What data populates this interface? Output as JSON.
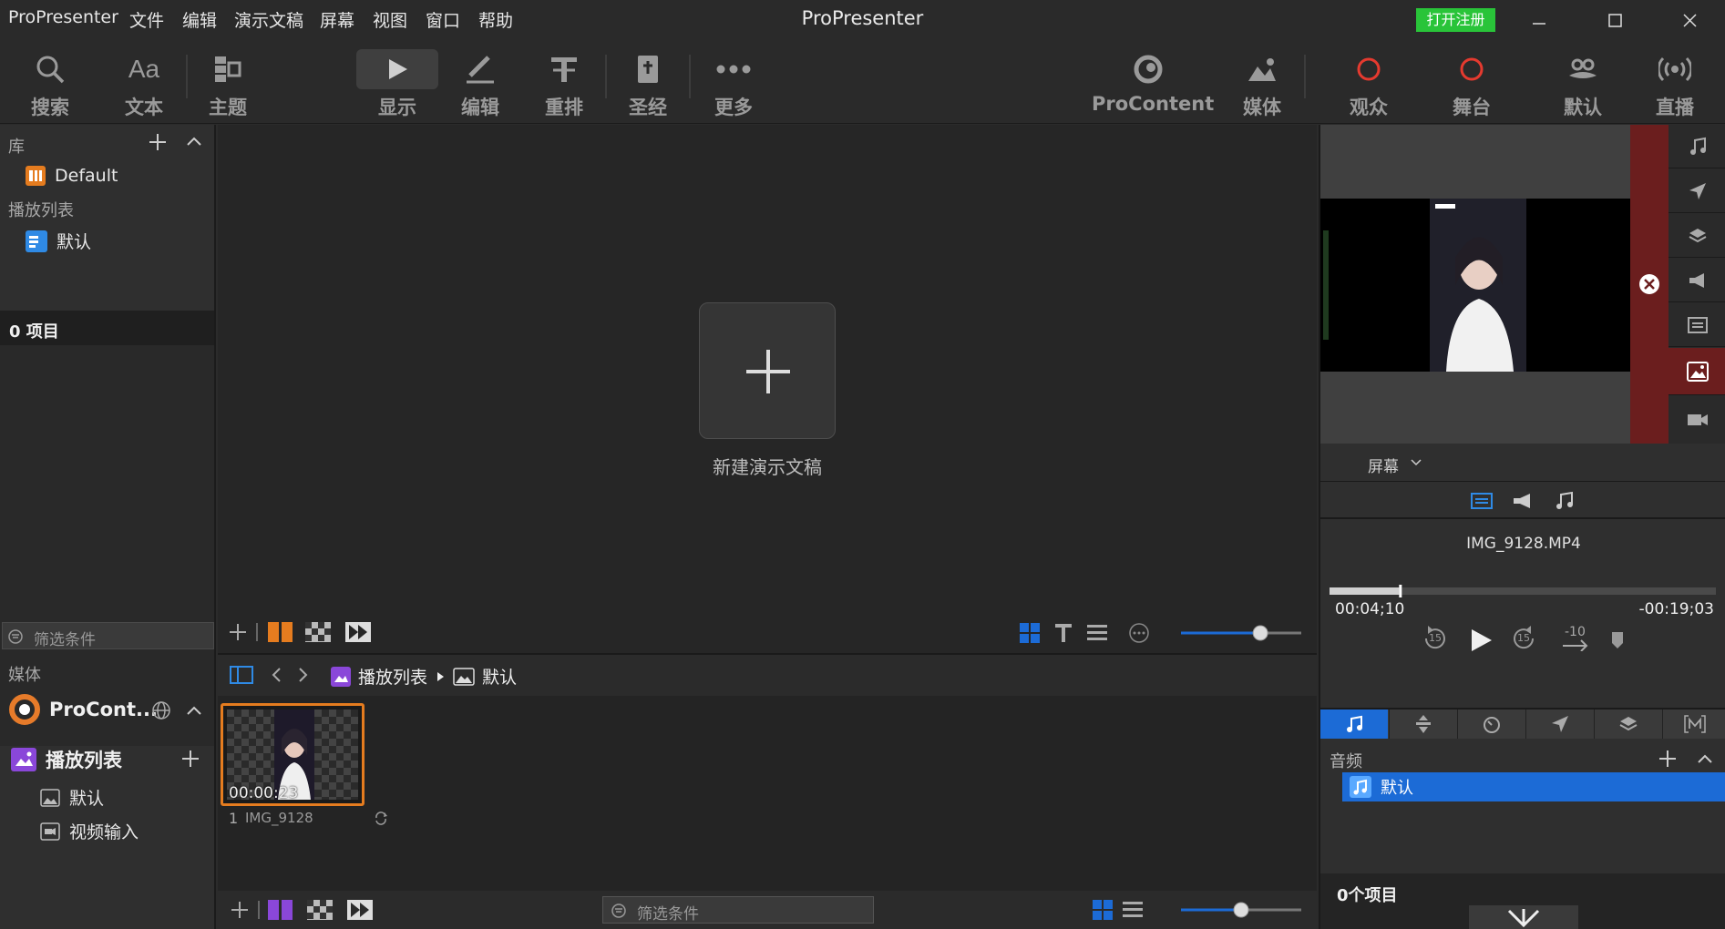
{
  "menu": {
    "app_name": "ProPresenter",
    "items": [
      "文件",
      "编辑",
      "演示文稿",
      "屏幕",
      "视图",
      "窗口",
      "帮助"
    ],
    "window_title": "ProPresenter",
    "register_label": "打开注册"
  },
  "toolbar": {
    "left": [
      {
        "label": "搜索",
        "icon": "search-icon"
      },
      {
        "label": "文本",
        "icon": "text-icon"
      },
      {
        "label": "主题",
        "icon": "theme-icon"
      }
    ],
    "middle": [
      {
        "label": "显示",
        "icon": "play-icon",
        "active": true
      },
      {
        "label": "编辑",
        "icon": "edit-icon"
      },
      {
        "label": "重排",
        "icon": "reflow-icon"
      },
      {
        "label": "圣经",
        "icon": "bible-icon"
      },
      {
        "label": "更多",
        "icon": "more-icon"
      }
    ],
    "right": [
      {
        "label": "ProContent",
        "icon": "procontent-icon"
      },
      {
        "label": "媒体",
        "icon": "media-icon"
      },
      {
        "label": "观众",
        "icon": "audience-icon"
      },
      {
        "label": "舞台",
        "icon": "stage-icon"
      },
      {
        "label": "默认",
        "icon": "default-look-icon"
      },
      {
        "label": "直播",
        "icon": "stream-icon"
      }
    ]
  },
  "library": {
    "title": "库",
    "items": [
      {
        "label": "Default"
      }
    ],
    "playlists_title": "播放列表",
    "playlists": [
      {
        "label": "默认"
      }
    ],
    "item_count": "0 项目",
    "filter_placeholder": "筛选条件"
  },
  "media_sidebar": {
    "title": "媒体",
    "source": "ProCont...",
    "playlist_title": "播放列表",
    "items": [
      {
        "label": "默认"
      },
      {
        "label": "视频输入"
      }
    ]
  },
  "center": {
    "new_presentation_label": "新建演示文稿",
    "zoom_top": 0.66
  },
  "media_bin": {
    "breadcrumb": [
      "播放列表",
      "默认"
    ],
    "items": [
      {
        "index": "1",
        "name": "IMG_9128",
        "duration": "00:00:23"
      }
    ],
    "filter_placeholder": "筛选条件",
    "zoom": 0.5
  },
  "preview": {
    "screen_label": "屏幕"
  },
  "transport": {
    "file_name": "IMG_9128.MP4",
    "elapsed": "00:04;10",
    "remaining": "-00:19;03",
    "progress": 0.18,
    "skip_back": "15",
    "skip_forward": "15",
    "jump": "-10"
  },
  "audio": {
    "title": "音频",
    "playlists": [
      {
        "label": "默认"
      }
    ],
    "item_count": "0个项目"
  },
  "colors": {
    "accent_blue": "#1c6bd6",
    "register_green": "#29c439",
    "live_red": "#e53a2f",
    "selected_orange": "#e57c1f",
    "playlist_purple": "#8a47d9",
    "preview_side_red": "#6b1e1e"
  }
}
